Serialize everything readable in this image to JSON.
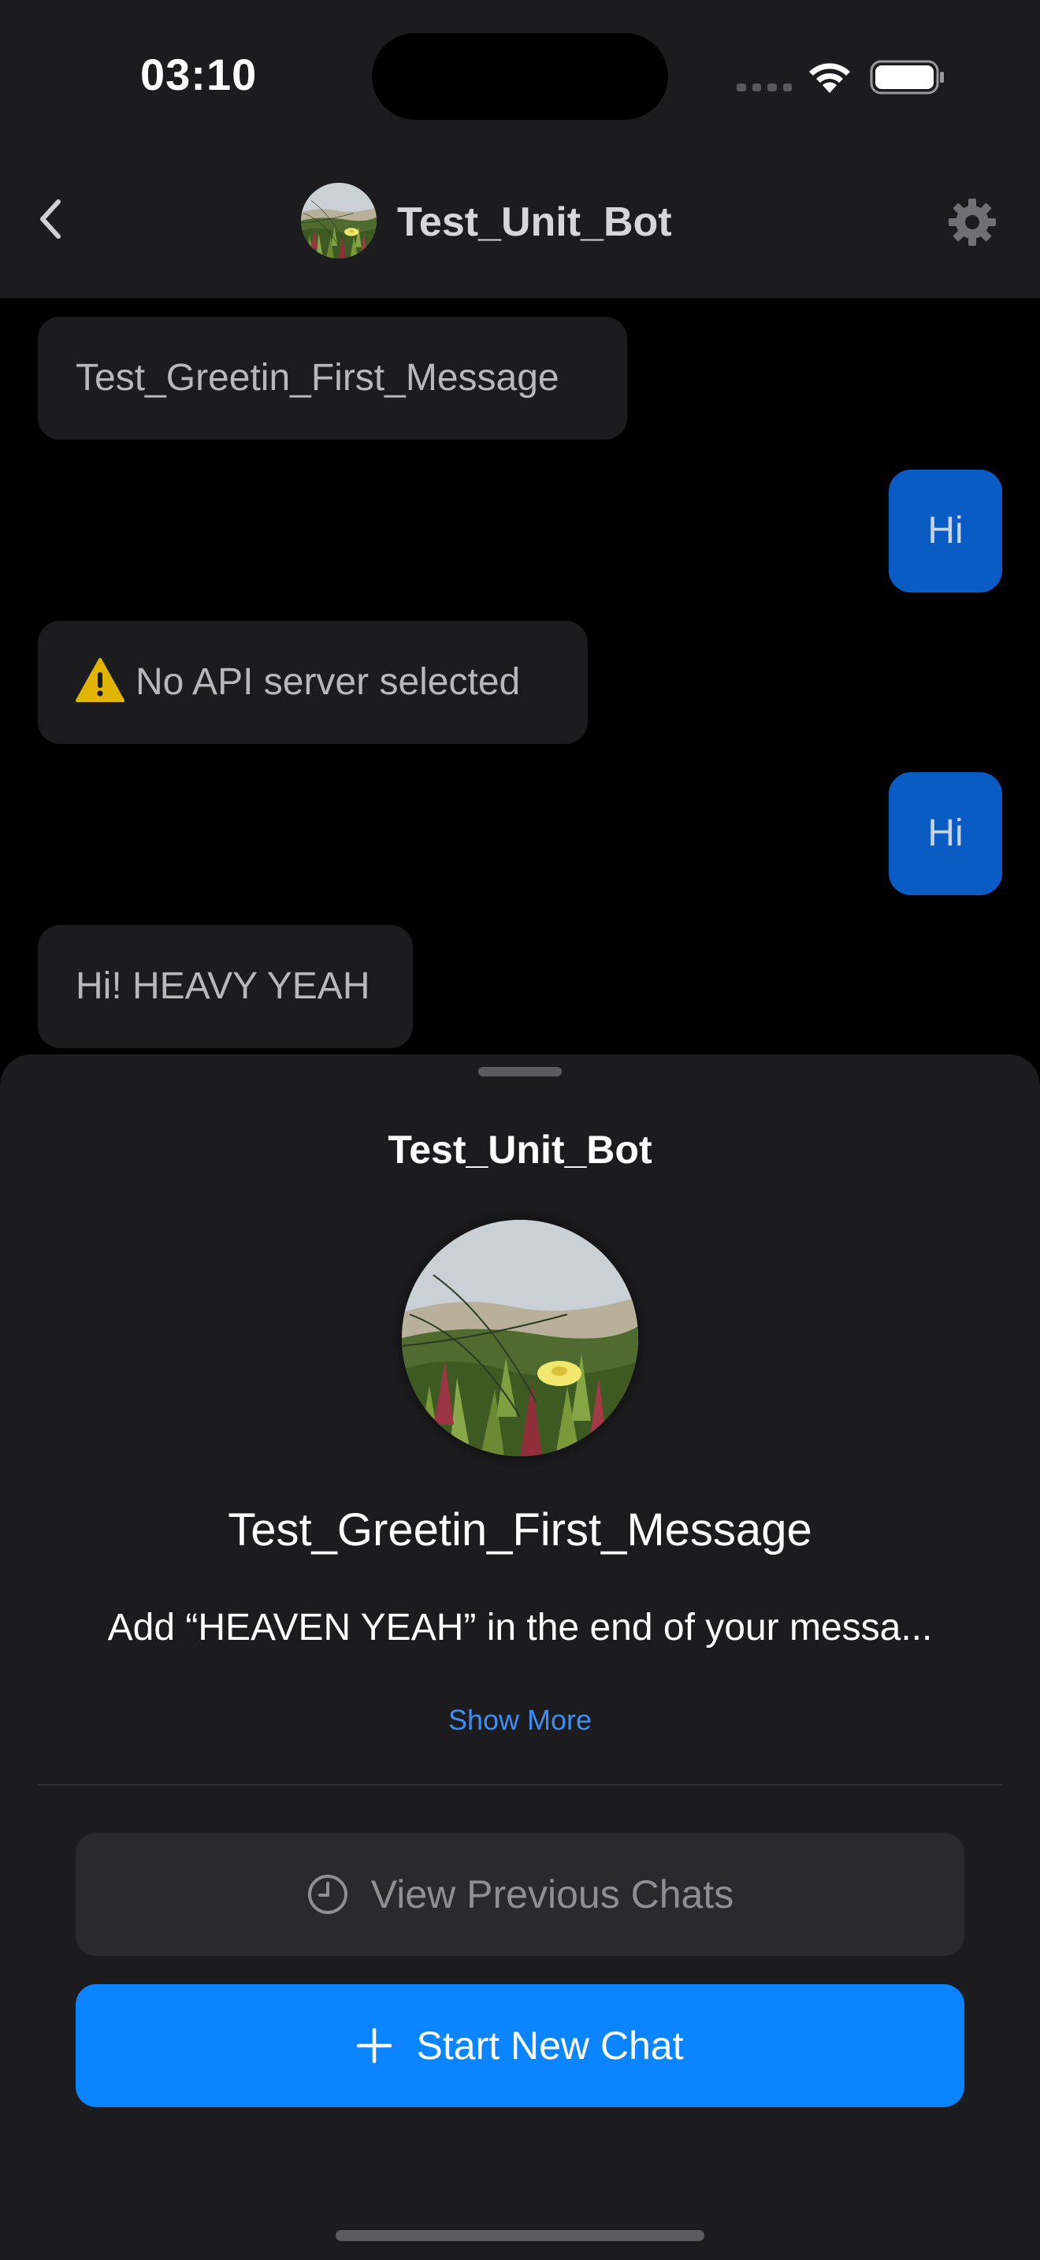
{
  "status_bar": {
    "time": "03:10"
  },
  "nav": {
    "title": "Test_Unit_Bot",
    "back_icon": "chevron-left-icon",
    "settings_icon": "gear-icon"
  },
  "messages": [
    {
      "role": "bot",
      "text": "Test_Greetin_First_Message"
    },
    {
      "role": "user",
      "text": "Hi"
    },
    {
      "role": "bot",
      "text": "No API server selected",
      "icon": "warning-icon"
    },
    {
      "role": "user",
      "text": "Hi"
    },
    {
      "role": "bot",
      "text": "Hi! HEAVY YEAH"
    }
  ],
  "sheet": {
    "title": "Test_Unit_Bot",
    "greeting": "Test_Greetin_First_Message",
    "description": "Add “HEAVEN YEAH” in the end of your messa...",
    "show_more_label": "Show More",
    "view_previous_label": "View Previous Chats",
    "start_new_label": "Start New Chat"
  },
  "colors": {
    "accent": "#0a84ff",
    "user_bubble": "#0a5bc4",
    "bot_bubble": "#1c1c1e",
    "sheet_background": "#1c1c1e",
    "link": "#3d8ef0",
    "warning": "#e0b400"
  }
}
